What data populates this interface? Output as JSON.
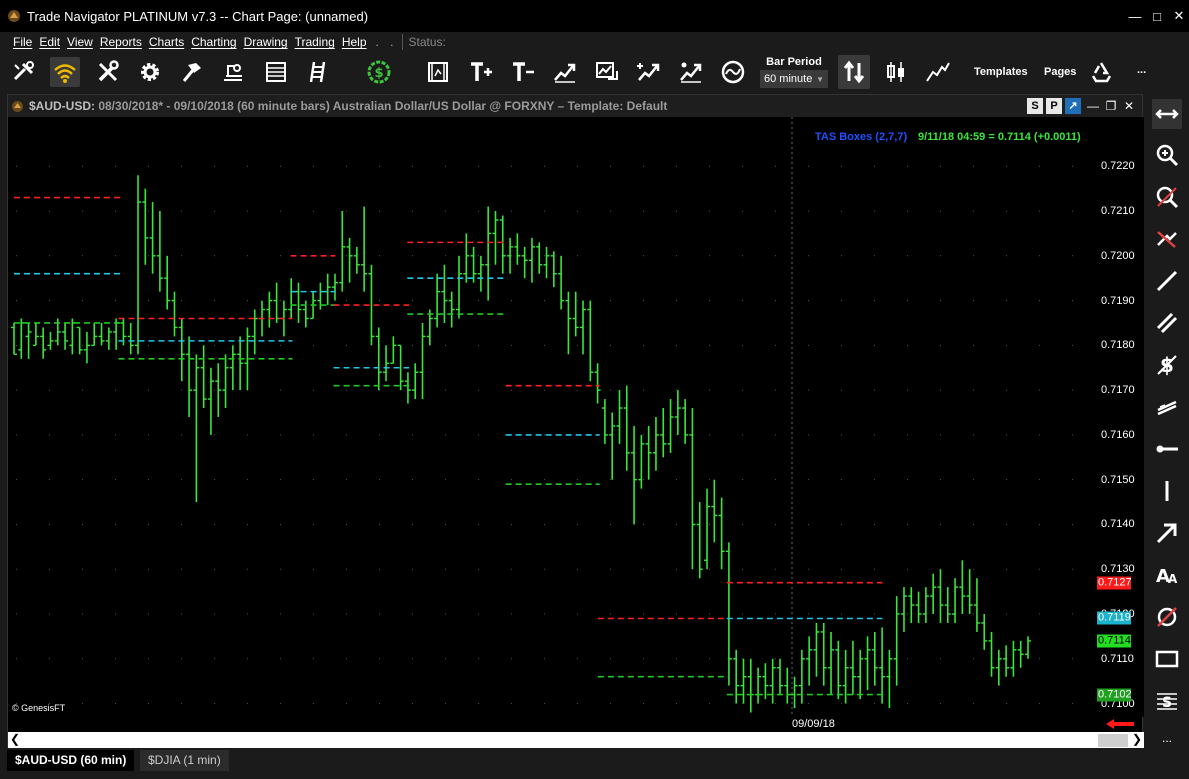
{
  "window": {
    "title": "Trade Navigator PLATINUM v7.3  --  Chart Page: (unnamed)"
  },
  "menu": {
    "items": [
      "File",
      "Edit",
      "View",
      "Reports",
      "Charts",
      "Charting",
      "Drawing",
      "Trading",
      "Help"
    ],
    "overflow": ". .",
    "status_label": "Status:"
  },
  "toolbar": {
    "icons": [
      "tools-icon",
      "wifi-icon",
      "wrench-icon",
      "gear-icon",
      "hammer-icon",
      "scale-icon",
      "list-icon",
      "ladder-icon",
      "dollar-icon",
      "film-icon",
      "text-plus-icon",
      "text-minus-icon",
      "chart-up-icon",
      "chart-box-icon",
      "chart-plus-icon",
      "chart-tools-icon",
      "chart-wave-icon",
      "sort-arrows-icon",
      "candlestick-icon",
      "line-chart-icon",
      "recycle-icon"
    ],
    "bar_period_label": "Bar Period",
    "bar_period_value": "60 minute",
    "templates_label": "Templates",
    "pages_label": "Pages",
    "more_label": "..."
  },
  "chart_window": {
    "symbol": "$AUD-USD:",
    "description": " 08/30/2018* - 09/10/2018  (60 minute bars)   Australian Dollar/US Dollar @ FORXNY  –  Template: Default",
    "btn_s": "S",
    "btn_p": "P",
    "legend_study": "TAS Boxes (2,7,7)",
    "legend_quote": "9/11/18 04:59 = 0.7114 (+0.0011)",
    "copyright": "© GenesisFT",
    "x_label": "09/09/18"
  },
  "colors": {
    "bars": "#39e639",
    "red_line": "#ff2020",
    "cyan_line": "#20c8e8",
    "green_line": "#20c820",
    "legend_study": "#2050ff",
    "legend_quote": "#39e639",
    "tag_red": "#ff1a1a",
    "tag_cyan": "#1ab2cc",
    "tag_green": "#22dd22",
    "tag_green_dark": "#1fa01f"
  },
  "chart_data": {
    "type": "ohlc",
    "ylim": [
      0.7097,
      0.7231
    ],
    "y_ticks": [
      "0.7220",
      "0.7210",
      "0.7200",
      "0.7190",
      "0.7180",
      "0.7170",
      "0.7160",
      "0.7150",
      "0.7140",
      "0.7130",
      "0.7120",
      "0.7110",
      "0.7100"
    ],
    "price_tags": [
      {
        "value": 0.7127,
        "label": "0.7127",
        "style": "red"
      },
      {
        "value": 0.7119,
        "label": "0.7119",
        "style": "cyan"
      },
      {
        "value": 0.7114,
        "label": "0.7114",
        "style": "green"
      },
      {
        "value": 0.7102,
        "label": "0.7102",
        "style": "green_dark"
      }
    ],
    "bar_count": 166,
    "bars": [
      [
        0.7185,
        0.7178,
        0.7184,
        0.7178
      ],
      [
        0.7186,
        0.7177,
        0.7179,
        0.7185
      ],
      [
        0.7185,
        0.7177,
        0.7182,
        0.7183
      ],
      [
        0.7185,
        0.718,
        0.718,
        0.7182
      ],
      [
        0.7184,
        0.7177,
        0.7182,
        0.7179
      ],
      [
        0.7183,
        0.7179,
        0.718,
        0.7181
      ],
      [
        0.7186,
        0.718,
        0.7181,
        0.7183
      ],
      [
        0.7185,
        0.7179,
        0.7183,
        0.7181
      ],
      [
        0.7186,
        0.7178,
        0.718,
        0.7185
      ],
      [
        0.7184,
        0.7178,
        0.7184,
        0.7179
      ],
      [
        0.7183,
        0.7176,
        0.7179,
        0.718
      ],
      [
        0.7185,
        0.718,
        0.718,
        0.7182
      ],
      [
        0.7185,
        0.718,
        0.7182,
        0.7181
      ],
      [
        0.7184,
        0.7179,
        0.7181,
        0.7183
      ],
      [
        0.7186,
        0.7179,
        0.7183,
        0.7185
      ],
      [
        0.7186,
        0.718,
        0.7185,
        0.7182
      ],
      [
        0.7185,
        0.7178,
        0.7182,
        0.718
      ],
      [
        0.7218,
        0.7178,
        0.718,
        0.7212
      ],
      [
        0.7215,
        0.7198,
        0.7212,
        0.7204
      ],
      [
        0.7212,
        0.7196,
        0.7204,
        0.72
      ],
      [
        0.721,
        0.7192,
        0.72,
        0.7195
      ],
      [
        0.72,
        0.7188,
        0.7195,
        0.719
      ],
      [
        0.7192,
        0.7182,
        0.719,
        0.7184
      ],
      [
        0.7186,
        0.7172,
        0.7184,
        0.7178
      ],
      [
        0.7182,
        0.7164,
        0.7178,
        0.717
      ],
      [
        0.7178,
        0.7145,
        0.717,
        0.7175
      ],
      [
        0.718,
        0.7166,
        0.7175,
        0.7168
      ],
      [
        0.7175,
        0.716,
        0.7168,
        0.7172
      ],
      [
        0.7176,
        0.7164,
        0.7172,
        0.717
      ],
      [
        0.7178,
        0.7166,
        0.717,
        0.7175
      ],
      [
        0.718,
        0.717,
        0.7175,
        0.7178
      ],
      [
        0.7182,
        0.717,
        0.7178,
        0.7176
      ],
      [
        0.7184,
        0.717,
        0.7176,
        0.7182
      ],
      [
        0.7188,
        0.7178,
        0.7182,
        0.7186
      ],
      [
        0.719,
        0.7182,
        0.7186,
        0.7188
      ],
      [
        0.7192,
        0.7184,
        0.7188,
        0.719
      ],
      [
        0.7194,
        0.7185,
        0.719,
        0.7186
      ],
      [
        0.719,
        0.7182,
        0.7186,
        0.7188
      ],
      [
        0.7195,
        0.7186,
        0.7188,
        0.7192
      ],
      [
        0.7194,
        0.7185,
        0.7192,
        0.7188
      ],
      [
        0.719,
        0.7184,
        0.7188,
        0.7186
      ],
      [
        0.7192,
        0.7186,
        0.7186,
        0.719
      ],
      [
        0.7194,
        0.7188,
        0.719,
        0.7192
      ],
      [
        0.7196,
        0.7189,
        0.7192,
        0.7193
      ],
      [
        0.7196,
        0.719,
        0.7193,
        0.7194
      ],
      [
        0.721,
        0.7192,
        0.7194,
        0.7202
      ],
      [
        0.7204,
        0.7194,
        0.7202,
        0.72
      ],
      [
        0.7202,
        0.7196,
        0.72,
        0.7198
      ],
      [
        0.7211,
        0.7192,
        0.7198,
        0.7196
      ],
      [
        0.7198,
        0.718,
        0.7196,
        0.7182
      ],
      [
        0.7184,
        0.717,
        0.7182,
        0.7174
      ],
      [
        0.718,
        0.7172,
        0.7174,
        0.7176
      ],
      [
        0.7182,
        0.7176,
        0.7176,
        0.718
      ],
      [
        0.718,
        0.717,
        0.718,
        0.7172
      ],
      [
        0.7174,
        0.7167,
        0.7172,
        0.717
      ],
      [
        0.7176,
        0.7168,
        0.717,
        0.7174
      ],
      [
        0.7185,
        0.7168,
        0.7174,
        0.7182
      ],
      [
        0.7188,
        0.718,
        0.7182,
        0.7186
      ],
      [
        0.7196,
        0.7184,
        0.7186,
        0.7192
      ],
      [
        0.7198,
        0.7185,
        0.7192,
        0.719
      ],
      [
        0.7192,
        0.7184,
        0.719,
        0.7188
      ],
      [
        0.72,
        0.7186,
        0.7188,
        0.7196
      ],
      [
        0.7205,
        0.7194,
        0.7196,
        0.72
      ],
      [
        0.7202,
        0.7194,
        0.72,
        0.7196
      ],
      [
        0.72,
        0.7192,
        0.7196,
        0.7198
      ],
      [
        0.7211,
        0.719,
        0.7198,
        0.7205
      ],
      [
        0.721,
        0.7198,
        0.7205,
        0.7208
      ],
      [
        0.7209,
        0.7196,
        0.7208,
        0.72
      ],
      [
        0.7204,
        0.7196,
        0.72,
        0.7202
      ],
      [
        0.7205,
        0.7198,
        0.7202,
        0.72
      ],
      [
        0.7202,
        0.7195,
        0.72,
        0.7199
      ],
      [
        0.7204,
        0.7194,
        0.7199,
        0.7202
      ],
      [
        0.7203,
        0.7196,
        0.7202,
        0.7198
      ],
      [
        0.7202,
        0.7195,
        0.7198,
        0.72
      ],
      [
        0.7201,
        0.7193,
        0.72,
        0.7196
      ],
      [
        0.72,
        0.7188,
        0.7196,
        0.719
      ],
      [
        0.7192,
        0.7178,
        0.719,
        0.7186
      ],
      [
        0.7192,
        0.7182,
        0.7186,
        0.7184
      ],
      [
        0.719,
        0.7178,
        0.7184,
        0.7188
      ],
      [
        0.719,
        0.7172,
        0.7188,
        0.7174
      ],
      [
        0.7176,
        0.7167,
        0.7174,
        0.717
      ],
      [
        0.7168,
        0.7158,
        0.7166,
        0.716
      ],
      [
        0.7165,
        0.715,
        0.716,
        0.7162
      ],
      [
        0.717,
        0.7158,
        0.7162,
        0.7166
      ],
      [
        0.7171,
        0.7152,
        0.7166,
        0.7156
      ],
      [
        0.7162,
        0.714,
        0.7156,
        0.715
      ],
      [
        0.716,
        0.7148,
        0.715,
        0.7158
      ],
      [
        0.7162,
        0.715,
        0.7158,
        0.7156
      ],
      [
        0.7164,
        0.7152,
        0.7156,
        0.716
      ],
      [
        0.7166,
        0.7155,
        0.716,
        0.7158
      ],
      [
        0.7168,
        0.7156,
        0.7158,
        0.7164
      ],
      [
        0.717,
        0.716,
        0.7164,
        0.7166
      ],
      [
        0.7168,
        0.7158,
        0.7166,
        0.716
      ],
      [
        0.7166,
        0.713,
        0.716,
        0.714
      ],
      [
        0.7145,
        0.7128,
        0.714,
        0.713
      ],
      [
        0.7148,
        0.713,
        0.7132,
        0.7144
      ],
      [
        0.715,
        0.7136,
        0.7144,
        0.7142
      ],
      [
        0.7146,
        0.713,
        0.7142,
        0.7134
      ],
      [
        0.7136,
        0.7104,
        0.7134,
        0.711
      ],
      [
        0.7112,
        0.71,
        0.711,
        0.7104
      ],
      [
        0.711,
        0.71,
        0.7104,
        0.7106
      ],
      [
        0.711,
        0.7098,
        0.7106,
        0.7102
      ],
      [
        0.7108,
        0.71,
        0.7102,
        0.7106
      ],
      [
        0.7109,
        0.7101,
        0.7106,
        0.7104
      ],
      [
        0.711,
        0.71,
        0.7104,
        0.7108
      ],
      [
        0.711,
        0.7102,
        0.7108,
        0.7104
      ],
      [
        0.7108,
        0.71,
        0.7104,
        0.7102
      ],
      [
        0.7106,
        0.7099,
        0.7102,
        0.7104
      ],
      [
        0.7112,
        0.71,
        0.7104,
        0.711
      ],
      [
        0.7115,
        0.7104,
        0.711,
        0.7112
      ],
      [
        0.7118,
        0.7106,
        0.7112,
        0.7116
      ],
      [
        0.7118,
        0.7104,
        0.7116,
        0.7108
      ],
      [
        0.7116,
        0.7102,
        0.7108,
        0.7112
      ],
      [
        0.7114,
        0.7101,
        0.7112,
        0.7104
      ],
      [
        0.7112,
        0.71,
        0.7104,
        0.7108
      ],
      [
        0.7114,
        0.7102,
        0.7108,
        0.7106
      ],
      [
        0.7112,
        0.7101,
        0.7106,
        0.711
      ],
      [
        0.7115,
        0.7103,
        0.711,
        0.7112
      ],
      [
        0.7116,
        0.7104,
        0.7112,
        0.7108
      ],
      [
        0.7117,
        0.71,
        0.7108,
        0.7106
      ],
      [
        0.7112,
        0.7099,
        0.7106,
        0.711
      ],
      [
        0.7124,
        0.7104,
        0.711,
        0.712
      ],
      [
        0.7126,
        0.7116,
        0.712,
        0.7124
      ],
      [
        0.7126,
        0.7118,
        0.7124,
        0.7122
      ],
      [
        0.7125,
        0.7118,
        0.7122,
        0.712
      ],
      [
        0.7126,
        0.7118,
        0.712,
        0.7124
      ],
      [
        0.7129,
        0.712,
        0.7124,
        0.7126
      ],
      [
        0.713,
        0.7118,
        0.7126,
        0.7122
      ],
      [
        0.7126,
        0.7118,
        0.7122,
        0.712
      ],
      [
        0.7128,
        0.7118,
        0.712,
        0.7126
      ],
      [
        0.7132,
        0.712,
        0.7126,
        0.7124
      ],
      [
        0.713,
        0.712,
        0.7124,
        0.7122
      ],
      [
        0.7128,
        0.7116,
        0.7122,
        0.7118
      ],
      [
        0.712,
        0.7112,
        0.7118,
        0.7114
      ],
      [
        0.7116,
        0.7106,
        0.7114,
        0.7108
      ],
      [
        0.7112,
        0.7104,
        0.7108,
        0.711
      ],
      [
        0.7113,
        0.7106,
        0.711,
        0.7108
      ],
      [
        0.7114,
        0.7106,
        0.7108,
        0.7112
      ],
      [
        0.7114,
        0.7108,
        0.7112,
        0.7111
      ],
      [
        0.7115,
        0.711,
        0.7111,
        0.7114
      ]
    ],
    "levels": [
      {
        "style": "red",
        "value": 0.7213,
        "start": 0,
        "end": 16
      },
      {
        "style": "cyan",
        "value": 0.7196,
        "start": 0,
        "end": 16
      },
      {
        "style": "green",
        "value": 0.7185,
        "start": 0,
        "end": 16
      },
      {
        "style": "red",
        "value": 0.7186,
        "start": 17,
        "end": 44
      },
      {
        "style": "cyan",
        "value": 0.7181,
        "start": 17,
        "end": 44
      },
      {
        "style": "green",
        "value": 0.7177,
        "start": 17,
        "end": 44
      },
      {
        "style": "red",
        "value": 0.72,
        "start": 45,
        "end": 51
      },
      {
        "style": "cyan",
        "value": 0.7192,
        "start": 45,
        "end": 51
      },
      {
        "style": "green",
        "value": 0.7189,
        "start": 45,
        "end": 51
      },
      {
        "style": "red",
        "value": 0.7189,
        "start": 52,
        "end": 63
      },
      {
        "style": "cyan",
        "value": 0.7175,
        "start": 52,
        "end": 63
      },
      {
        "style": "green",
        "value": 0.7171,
        "start": 52,
        "end": 63
      },
      {
        "style": "red",
        "value": 0.7203,
        "start": 64,
        "end": 79
      },
      {
        "style": "cyan",
        "value": 0.7195,
        "start": 64,
        "end": 79
      },
      {
        "style": "green",
        "value": 0.7187,
        "start": 64,
        "end": 79
      },
      {
        "style": "red",
        "value": 0.7171,
        "start": 80,
        "end": 94
      },
      {
        "style": "cyan",
        "value": 0.716,
        "start": 80,
        "end": 94
      },
      {
        "style": "green",
        "value": 0.7149,
        "start": 80,
        "end": 94
      },
      {
        "style": "red",
        "value": 0.7119,
        "start": 95,
        "end": 115
      },
      {
        "style": "green",
        "value": 0.7106,
        "start": 95,
        "end": 115
      },
      {
        "style": "red",
        "value": 0.7127,
        "start": 116,
        "end": 140
      },
      {
        "style": "cyan",
        "value": 0.7119,
        "start": 116,
        "end": 140
      },
      {
        "style": "green",
        "value": 0.7102,
        "start": 116,
        "end": 140
      }
    ]
  },
  "sidebar": {
    "icons": [
      "pan-arrows-icon",
      "zoom-in-icon",
      "zoom-out-icon",
      "no-draw-icon",
      "pencil-line-icon",
      "parallel-lines-icon",
      "dollar-strike-icon",
      "channel-icon",
      "horizontal-line-icon",
      "vertical-line-icon",
      "arrow-icon",
      "text-icon",
      "eraser-icon",
      "rectangle-icon",
      "fibonacci-icon"
    ],
    "more_label": "..."
  },
  "tabs": {
    "active": "$AUD-USD (60 min)",
    "inactive": "$DJIA (1 min)"
  }
}
